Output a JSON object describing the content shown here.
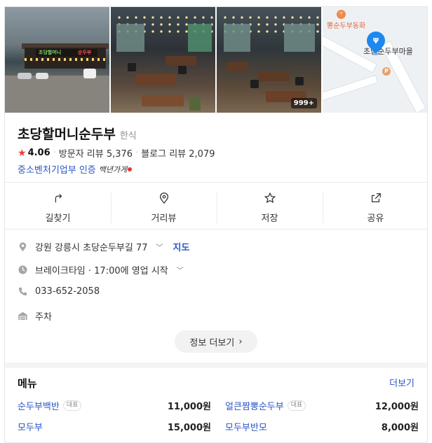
{
  "place": {
    "name": "초당할머니순두부",
    "category": "한식",
    "rating": "4.06",
    "visitor_reviews": "방문자 리뷰 5,376",
    "blog_reviews": "블로그 리뷰 2,079",
    "certification": "중소벤처기업부 인증",
    "badge_script": "백년가게"
  },
  "photos": {
    "count_badge": "999+",
    "sign_green": "초당할머니",
    "sign_red": "순두부",
    "map_poi_top": "뽕순두부동화",
    "map_poi_main": "초당순두부마을",
    "map_parking": "P"
  },
  "actions": [
    {
      "label": "길찾기",
      "icon": "directions-icon"
    },
    {
      "label": "거리뷰",
      "icon": "location-pin-icon"
    },
    {
      "label": "저장",
      "icon": "star-icon"
    },
    {
      "label": "공유",
      "icon": "share-icon"
    }
  ],
  "info": {
    "address": "강원 강릉시 초당순두부길 77",
    "map_link": "지도",
    "hours": "브레이크타임 · 17:00에 영업 시작",
    "phone": "033-652-2058",
    "parking": "주차",
    "more_button": "정보 더보기"
  },
  "menu": {
    "title": "메뉴",
    "more": "더보기",
    "rep_badge": "대표",
    "items": [
      {
        "name": "순두부백반",
        "price": "11,000원",
        "rep": true
      },
      {
        "name": "얼큰짬뽕순두부",
        "price": "12,000원",
        "rep": true
      },
      {
        "name": "모두부",
        "price": "15,000원",
        "rep": false
      },
      {
        "name": "모두부반모",
        "price": "8,000원",
        "rep": false
      }
    ]
  },
  "colors": {
    "accent_blue": "#2a56c6",
    "star_red": "#f03c3c",
    "pin_blue": "#1e88f0"
  }
}
